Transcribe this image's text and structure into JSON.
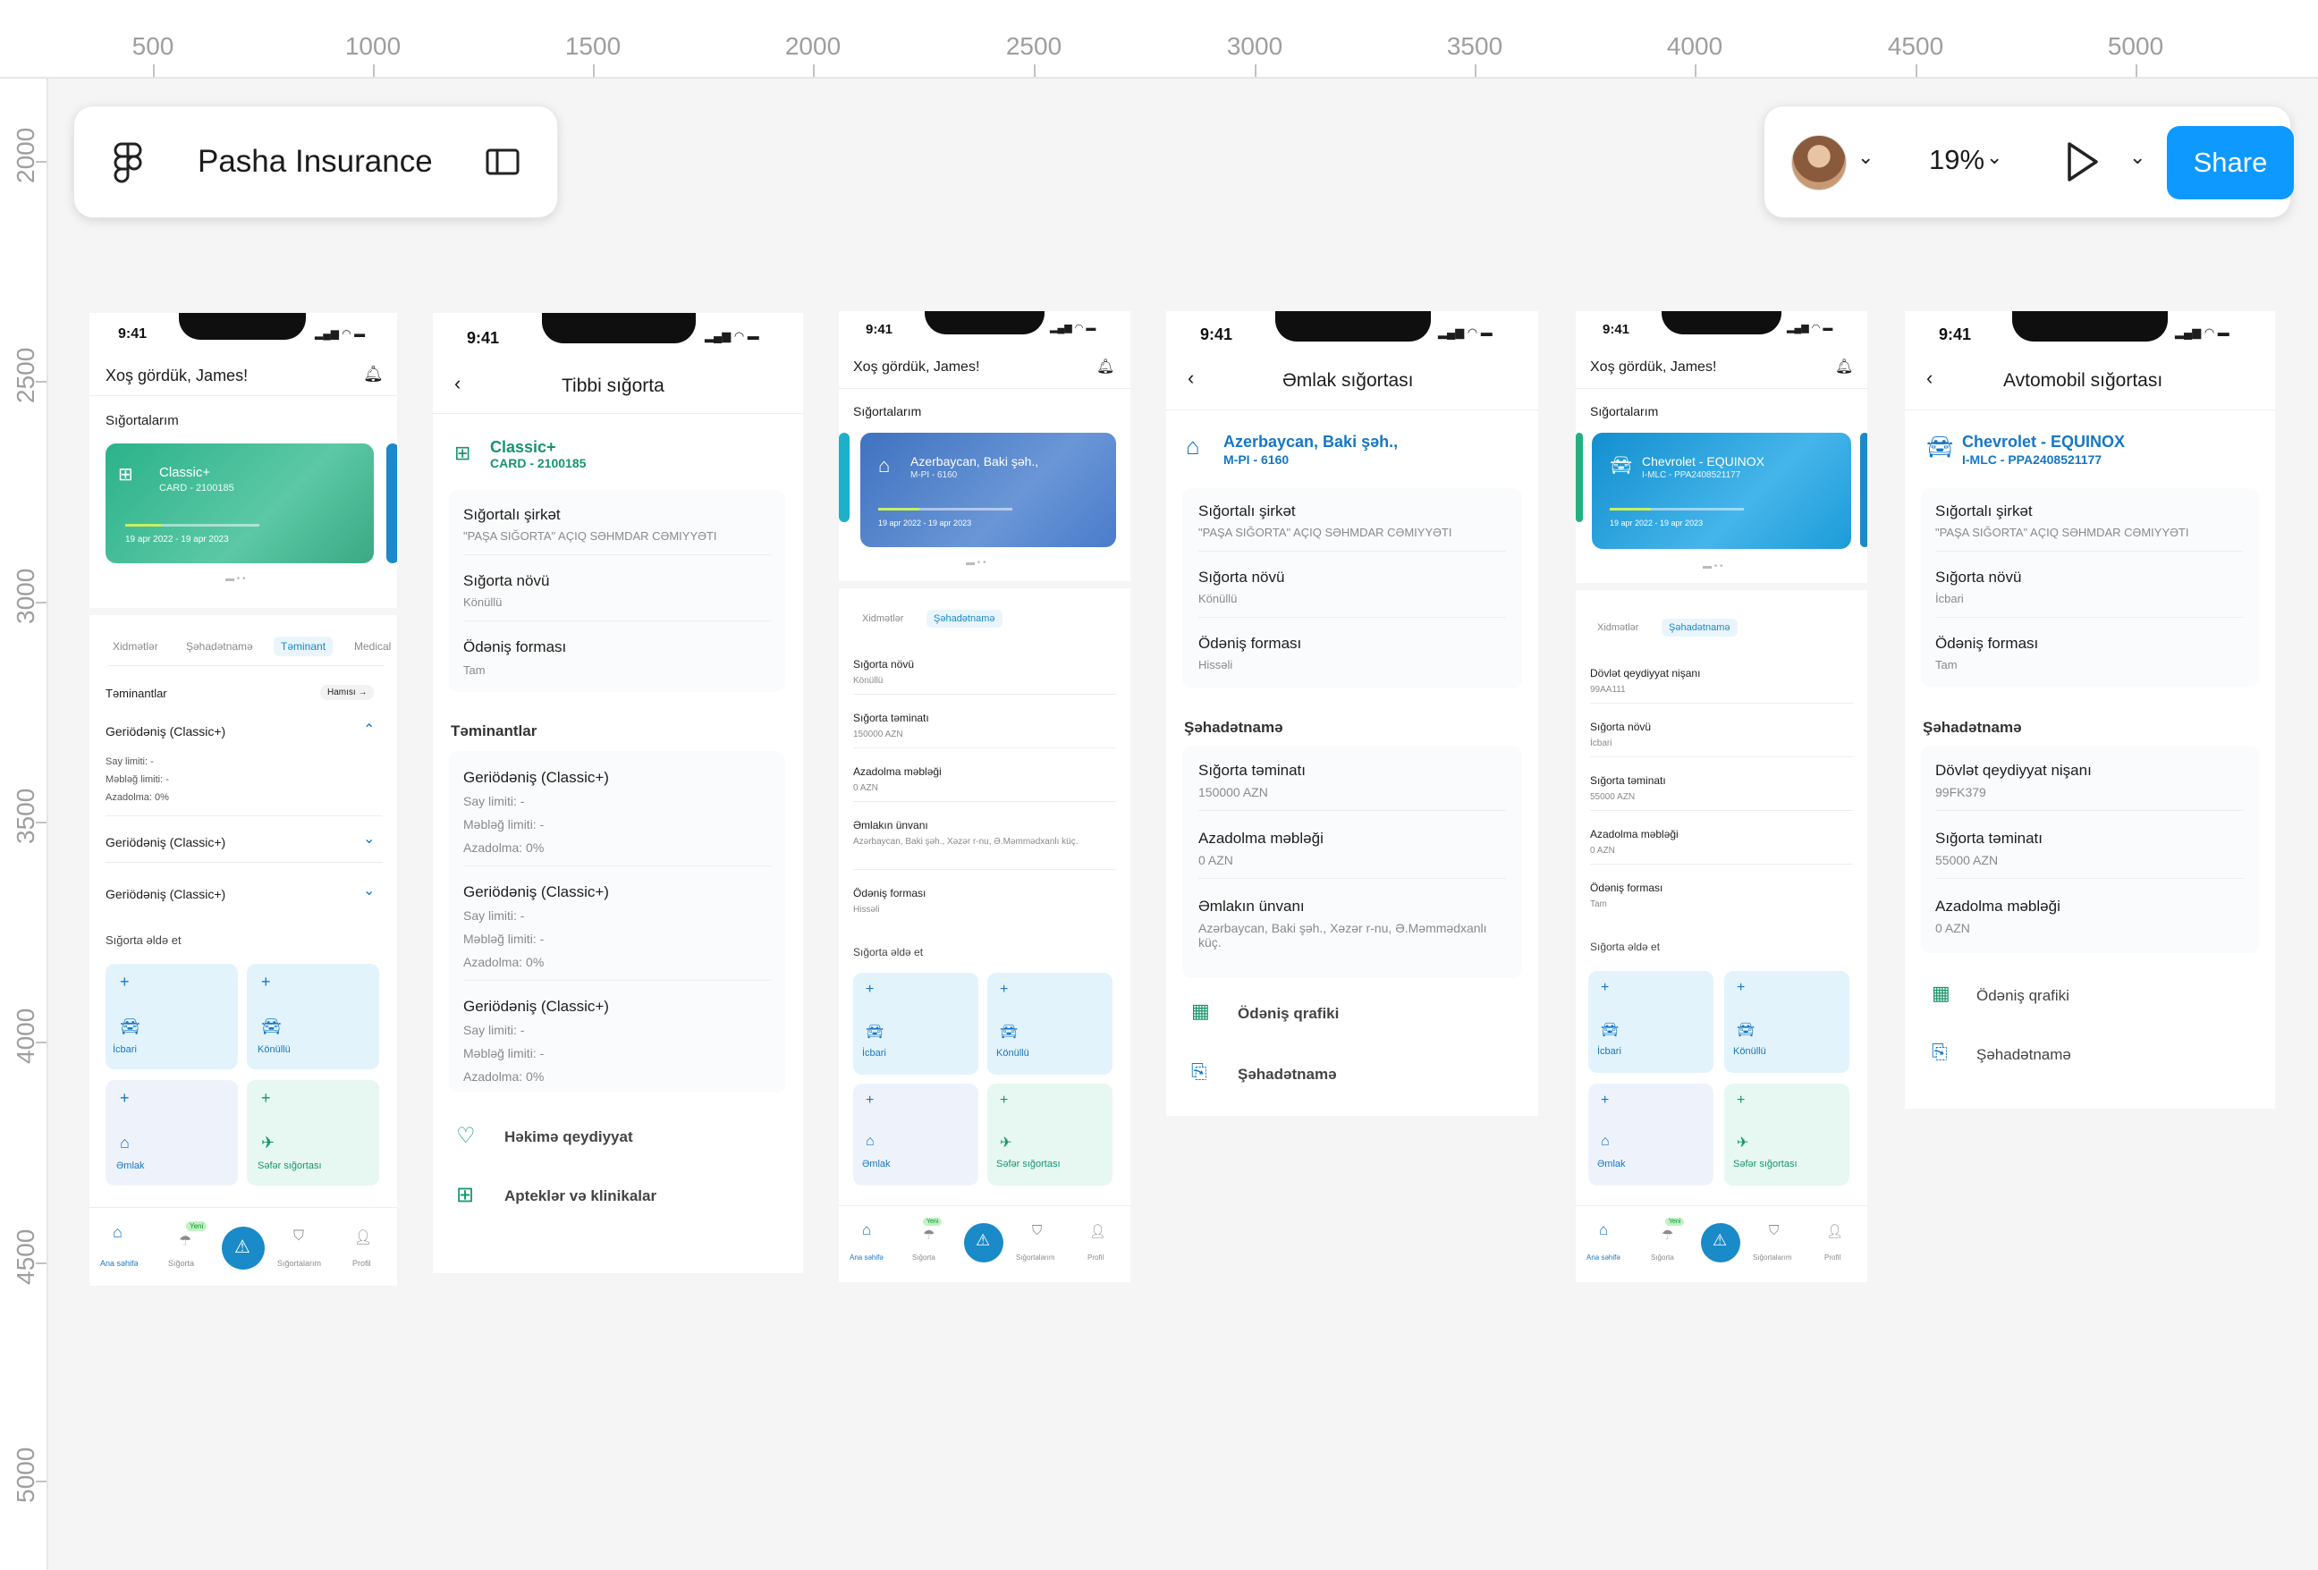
{
  "ruler": {
    "top": [
      "500",
      "1000",
      "1500",
      "2000",
      "2500",
      "3000",
      "3500",
      "4000",
      "4500",
      "5000"
    ],
    "left": [
      "2000",
      "2500",
      "3000",
      "3500",
      "4000",
      "4500",
      "5000"
    ]
  },
  "file": {
    "title": "Pasha Insurance"
  },
  "toolbar": {
    "zoom": "19%",
    "share": "Share"
  },
  "common": {
    "time": "9:41",
    "welcome": "Xoş gördük, James!",
    "my_insurances": "Sığortalarım",
    "get_insurance": "Sığorta əldə et",
    "company_label": "Sığortalı şirkət",
    "company_value": "\"PAŞA SIĞORTA\" AÇIQ SƏHMDAR CƏMIYYƏTI",
    "type_label": "Sığorta növü",
    "type_value": "Könüllü",
    "type_value_mand": "İcbari",
    "pay_label": "Ödəniş forması",
    "pay_tam": "Tam",
    "pay_hisseli": "Hissəli",
    "cert_section": "Şəhadətnamə",
    "sum_label": "Sığorta təminatı",
    "deduct_label": "Azadolma məbləği",
    "deduct_value": "0 AZN",
    "addr_label": "Əmlakın ünvanı",
    "addr_value": "Azərbaycan, Baki şəh., Xəzər r-nu, Ə.Məmmədxanlı küç.",
    "plate_label": "Dövlət qeydiyyat nişanı",
    "schedule": "Ödəniş qrafiki"
  },
  "tiles": [
    "İcbari",
    "Könüllü",
    "Əmlak",
    "Səfər sığortası"
  ],
  "nav": {
    "home": "Ana səhifə",
    "ins": "Sığorta",
    "mine": "Sığortalarım",
    "profile": "Profil",
    "new": "Yeni"
  },
  "s1": {
    "card_title": "Classic+",
    "card_sub": "CARD - 2100185",
    "card_dates": "19 apr 2022 - 19 apr 2023",
    "tabs": [
      "Xidmətlər",
      "Şəhadətnamə",
      "Təminant",
      "Medical"
    ],
    "coverages": "Təminantlar",
    "all": "Hamısı",
    "item": "Geriödəniş (Classic+)",
    "say": "Say limiti: -",
    "mebleg": "Məbləğ limiti: -",
    "azad": "Azadolma: 0%"
  },
  "s2": {
    "header": "Tibbi sığorta",
    "name": "Classic+",
    "sub": "CARD - 2100185",
    "section": "Təminantlar",
    "item": "Geriödəniş (Classic+)",
    "say": "Say limiti: -",
    "mebleg": "Məbləğ limiti: -",
    "azad": "Azadolma: 0%",
    "doctor": "Həkimə qeydiyyat",
    "pharm": "Apteklər və klinikalar"
  },
  "s3": {
    "card_title": "Azerbaycan, Baki şəh.,",
    "card_sub": "M-PI - 6160",
    "card_dates": "19 apr 2022 - 19 apr 2023",
    "tabs": [
      "Xidmətlər",
      "Şəhadətnamə"
    ],
    "sum": "150000 AZN"
  },
  "s4": {
    "header": "Əmlak sığortası",
    "name": "Azerbaycan, Baki şəh.,",
    "sub": "M-PI - 6160",
    "sum": "150000 AZN"
  },
  "s5": {
    "card_title": "Chevrolet - EQUINOX",
    "card_sub": "I-MLC - PPA2408521177",
    "card_dates": "19 apr 2022 - 19 apr 2023",
    "tabs": [
      "Xidmətlər",
      "Şəhadətnamə"
    ],
    "plate": "99AA111",
    "sum": "55000 AZN"
  },
  "s6": {
    "header": "Avtomobil sığortası",
    "name": "Chevrolet - EQUINOX",
    "sub": "I-MLC - PPA2408521177",
    "plate": "99FK379",
    "sum": "55000 AZN"
  }
}
